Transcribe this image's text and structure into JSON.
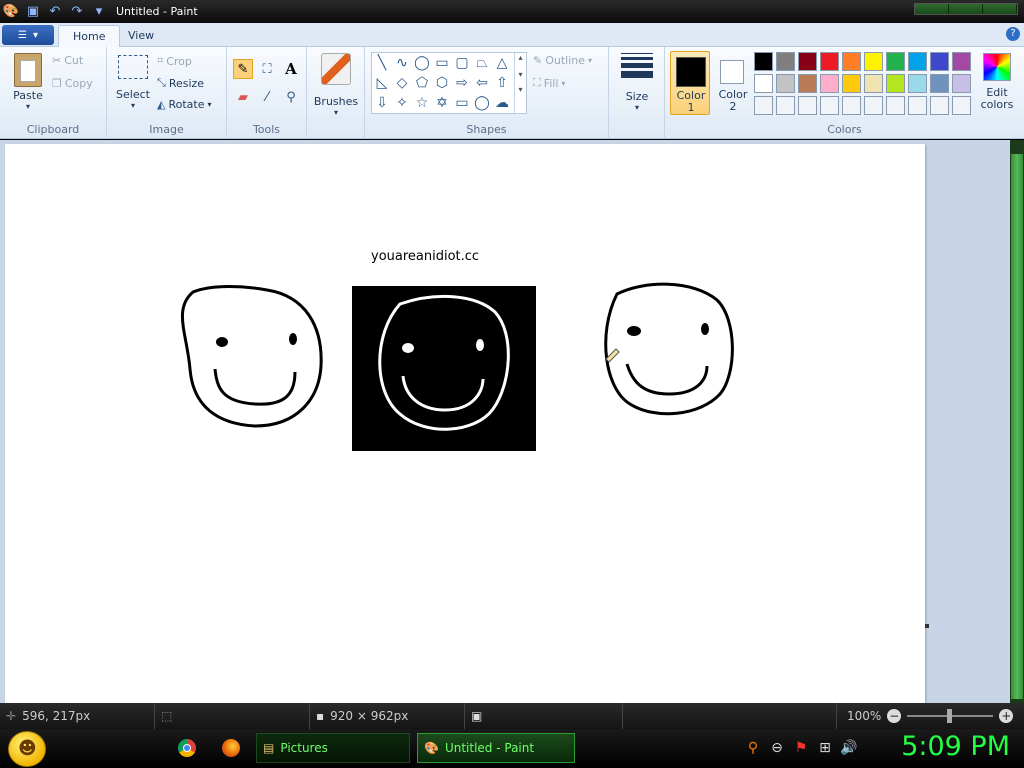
{
  "window": {
    "title": "Untitled - Paint"
  },
  "tabs": [
    {
      "label": "Home"
    },
    {
      "label": "View"
    }
  ],
  "clipboard": {
    "paste": "Paste",
    "cut": "Cut",
    "copy": "Copy",
    "group": "Clipboard"
  },
  "image": {
    "select": "Select",
    "crop": "Crop",
    "resize": "Resize",
    "rotate": "Rotate",
    "group": "Image"
  },
  "tools": {
    "group": "Tools"
  },
  "brushes": {
    "label": "Brushes"
  },
  "shapes": {
    "outline": "Outline",
    "fill": "Fill",
    "group": "Shapes"
  },
  "size": {
    "label": "Size"
  },
  "colors": {
    "color1_a": "Color",
    "color1_b": "1",
    "color2_a": "Color",
    "color2_b": "2",
    "edit_a": "Edit",
    "edit_b": "colors",
    "group": "Colors",
    "row1": [
      "#000000",
      "#7f7f7f",
      "#880015",
      "#ed1c24",
      "#ff7f27",
      "#fff200",
      "#22b14c",
      "#00a2e8",
      "#3f48cc",
      "#a349a4"
    ],
    "row2": [
      "#ffffff",
      "#c3c3c3",
      "#b97a57",
      "#ffaec9",
      "#ffc90e",
      "#efe4b0",
      "#b5e61d",
      "#99d9ea",
      "#7092be",
      "#c8bfe7"
    ],
    "row3": [
      "#f0f4f9",
      "#f0f4f9",
      "#f0f4f9",
      "#f0f4f9",
      "#f0f4f9",
      "#f0f4f9",
      "#f0f4f9",
      "#f0f4f9",
      "#f0f4f9",
      "#f0f4f9"
    ]
  },
  "canvas": {
    "text": "youareanidiot.cc"
  },
  "status": {
    "cursor": "596, 217px",
    "size": "920 × 962px",
    "zoom": "100%"
  },
  "taskbar": {
    "pictures": "Pictures",
    "paint": "Untitled - Paint",
    "clock": "5:09 PM"
  }
}
